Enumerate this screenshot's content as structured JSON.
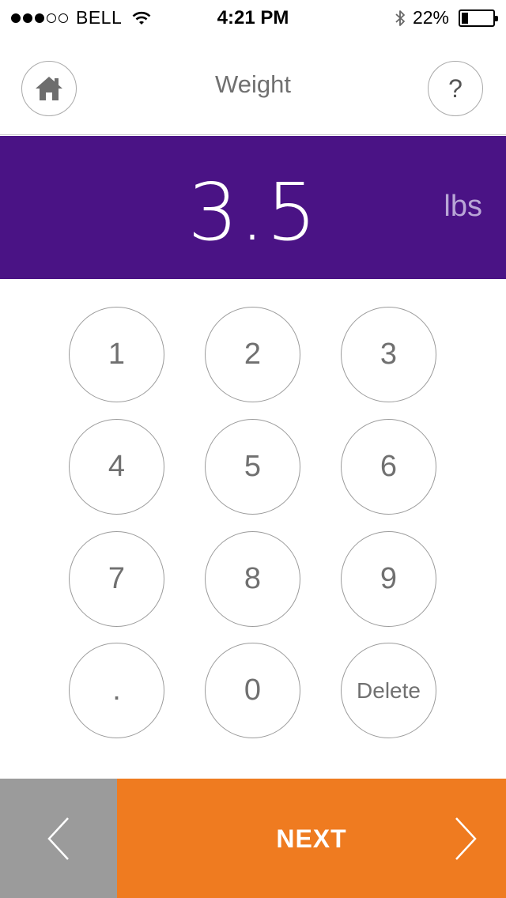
{
  "status_bar": {
    "carrier": "BELL",
    "time": "4:21 PM",
    "battery": "22%",
    "battery_level": 0.22,
    "signal_bars": 3,
    "signal_total": 5
  },
  "nav": {
    "title": "Weight",
    "home_icon": "home-icon",
    "help_label": "?"
  },
  "display": {
    "value": "3.5",
    "unit": "lbs",
    "background": "#4a1385"
  },
  "keypad": {
    "keys": [
      "1",
      "2",
      "3",
      "4",
      "5",
      "6",
      "7",
      "8",
      "9",
      ".",
      "0",
      "Delete"
    ]
  },
  "footer": {
    "back_icon": "chevron-left-icon",
    "next_label": "NEXT",
    "next_icon": "chevron-right-icon",
    "next_color": "#ef7b20",
    "back_color": "#9b9b9b"
  }
}
